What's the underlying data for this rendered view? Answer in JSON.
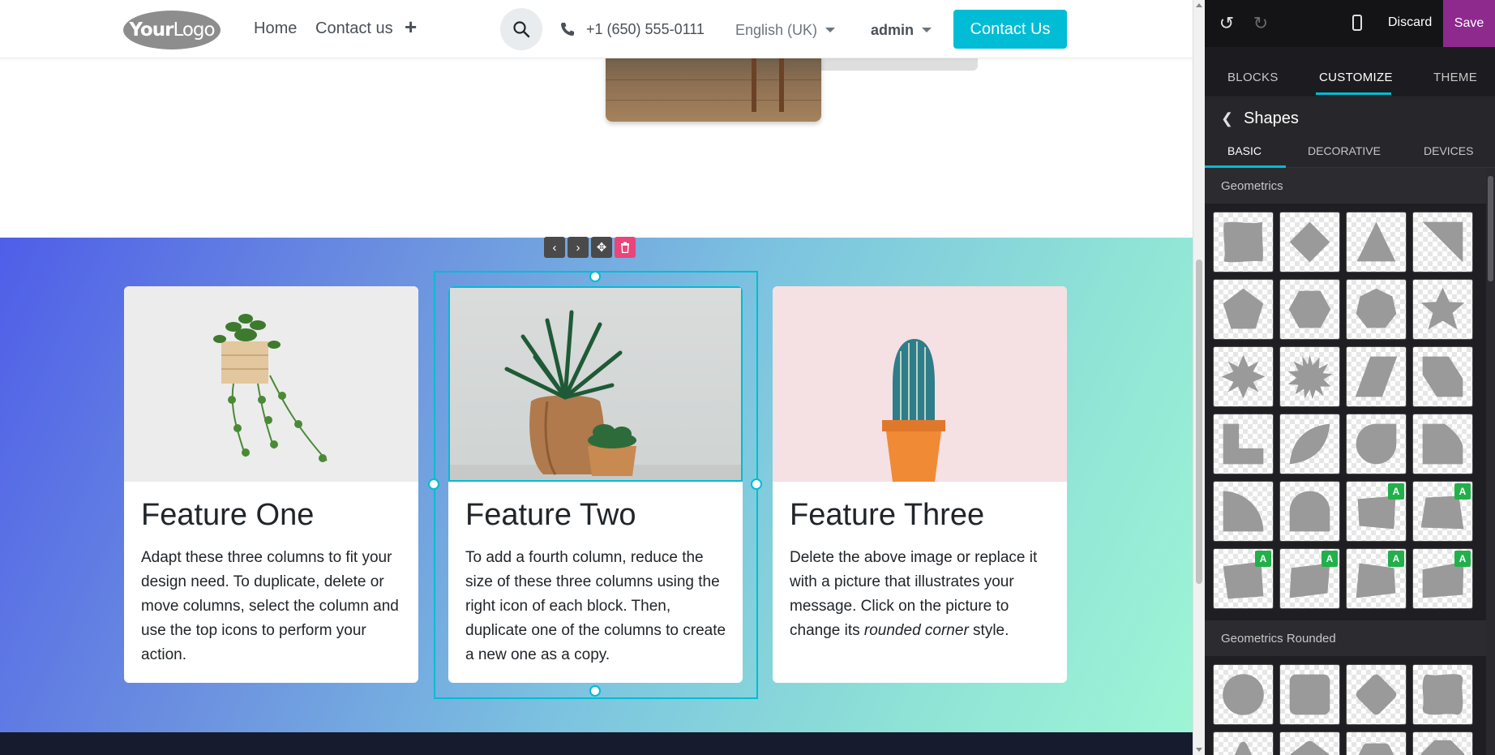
{
  "navbar": {
    "logo_text_bold": "Your",
    "logo_text_thin": "Logo",
    "links": [
      "Home",
      "Contact us"
    ],
    "phone": "+1 (650) 555-0111",
    "language": "English (UK)",
    "user": "admin",
    "cta": "Contact Us"
  },
  "features": [
    {
      "title": "Feature One",
      "text": "Adapt these three columns to fit your design need. To duplicate, delete or move columns, select the column and use the top icons to perform your action."
    },
    {
      "title": "Feature Two",
      "text": "To add a fourth column, reduce the size of these three columns using the right icon of each block. Then, duplicate one of the columns to create a new one as a copy."
    },
    {
      "title": "Feature Three",
      "text_before": "Delete the above image or replace it with a picture that illustrates your message. Click on the picture to change its ",
      "text_em": "rounded corner",
      "text_after": " style."
    }
  ],
  "editor": {
    "discard": "Discard",
    "save": "Save",
    "tabs": [
      "BLOCKS",
      "CUSTOMIZE",
      "THEME"
    ],
    "active_tab": "CUSTOMIZE",
    "panel_title": "Shapes",
    "sub_tabs": [
      "BASIC",
      "DECORATIVE",
      "DEVICES"
    ],
    "active_sub_tab": "BASIC",
    "sections": [
      "Geometrics",
      "Geometrics Rounded"
    ],
    "badge_label": "A",
    "colors": {
      "accent": "#00bcd4",
      "save": "#8e2a8e",
      "delete": "#e9457a",
      "badge": "#21b04a"
    }
  }
}
